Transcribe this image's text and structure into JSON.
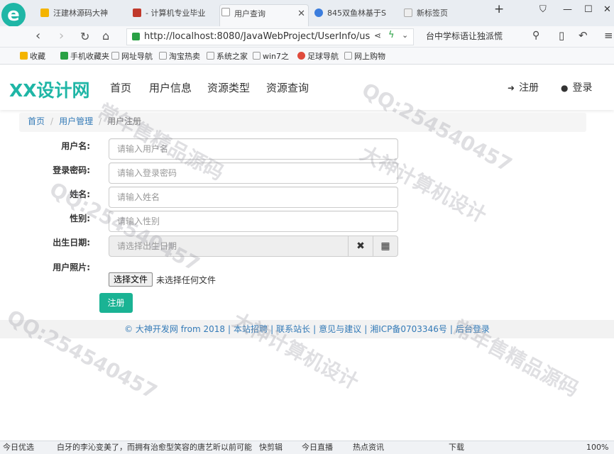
{
  "browser": {
    "tabs": [
      {
        "label": "汪建林源码大神"
      },
      {
        "label": "- 计算机专业毕业"
      },
      {
        "label": "用户查询"
      },
      {
        "label": "845双鱼林基于S"
      },
      {
        "label": "新标签页"
      }
    ],
    "url": "http://localhost:8080/JavaWebProject/UserInfo/us",
    "search_text": "台中学标语让独派慌",
    "bookmarks": [
      {
        "label": "收藏"
      },
      {
        "label": "手机收藏夹"
      },
      {
        "label": "网址导航"
      },
      {
        "label": "淘宝热卖"
      },
      {
        "label": "系统之家"
      },
      {
        "label": "win7之"
      },
      {
        "label": "足球导航"
      },
      {
        "label": "网上购物"
      }
    ]
  },
  "site": {
    "logo": "XX设计网",
    "nav": [
      {
        "label": "首页"
      },
      {
        "label": "用户信息"
      },
      {
        "label": "资源类型"
      },
      {
        "label": "资源查询"
      }
    ],
    "register": "注册",
    "login": "登录"
  },
  "breadcrumb": {
    "home": "首页",
    "section": "用户管理",
    "current": "用户注册"
  },
  "form": {
    "username": {
      "label": "用户名:",
      "placeholder": "请输入用户名"
    },
    "password": {
      "label": "登录密码:",
      "placeholder": "请输入登录密码"
    },
    "name": {
      "label": "姓名:",
      "placeholder": "请输入姓名"
    },
    "gender": {
      "label": "性别:",
      "placeholder": "请输入性别"
    },
    "birthday": {
      "label": "出生日期:",
      "placeholder": "请选择出生日期"
    },
    "photo": {
      "label": "用户照片:",
      "button": "选择文件",
      "status": "未选择任何文件"
    },
    "submit": "注册"
  },
  "footer": {
    "copyright": "© 大神开发网 from 2018",
    "links": [
      "本站招聘",
      "联系站长",
      "意见与建议",
      "湘ICP备0703346号",
      "后台登录"
    ]
  },
  "statusbar": {
    "left": "今日优选",
    "news": "白牙的李沁变美了，而拥有治愈型笑容的唐艺昕以前可能",
    "items": [
      "快剪辑",
      "今日直播",
      "热点资讯",
      "下载"
    ],
    "zoom": "100%"
  },
  "watermarks": [
    "大神计算机设计",
    "QQ:254540457",
    "常年售精品源码"
  ]
}
